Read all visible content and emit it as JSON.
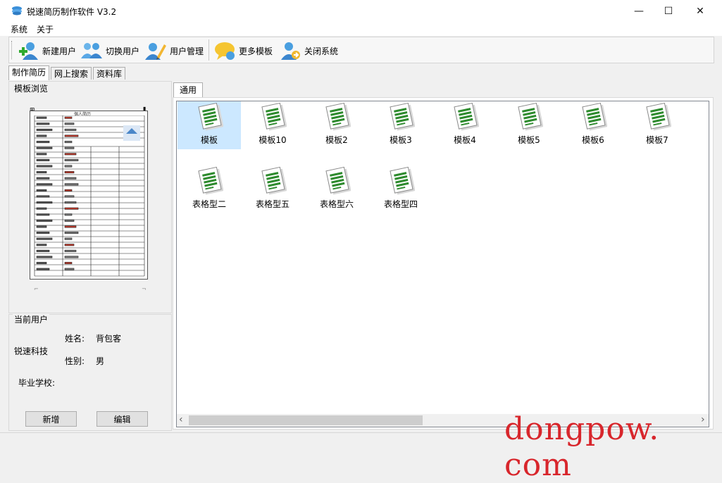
{
  "window": {
    "title": "锐速简历制作软件  V3.2",
    "minimize": "—",
    "maximize": "☐",
    "close": "✕"
  },
  "menu": [
    "系统",
    "关于"
  ],
  "toolbar": [
    {
      "label": "新建用户",
      "icon": "user-add-icon"
    },
    {
      "label": "切换用户",
      "icon": "users-switch-icon"
    },
    {
      "label": "用户管理",
      "icon": "user-edit-icon"
    },
    {
      "label": "更多模板",
      "icon": "chat-bubble-icon"
    },
    {
      "label": "关闭系统",
      "icon": "user-exit-icon"
    }
  ],
  "main_tabs": [
    "制作简历",
    "网上搜索",
    "资料库"
  ],
  "preview": {
    "caption": "模板浏览",
    "paper_title": "個人简历"
  },
  "current_user": {
    "caption": "当前用户",
    "company": "锐速科技",
    "name_label": "姓名:",
    "name_value": "背包客",
    "gender_label": "性别:",
    "gender_value": "男",
    "school_label": "毕业学校:",
    "add_button": "新增",
    "edit_button": "编辑"
  },
  "templates_tab": "通用",
  "templates": [
    {
      "label": "模板",
      "selected": true
    },
    {
      "label": "模板10"
    },
    {
      "label": "模板2"
    },
    {
      "label": "模板3"
    },
    {
      "label": "模板4"
    },
    {
      "label": "模板5"
    },
    {
      "label": "模板6"
    },
    {
      "label": "模板7"
    },
    {
      "label": "表格型二"
    },
    {
      "label": "表格型五"
    },
    {
      "label": "表格型六"
    },
    {
      "label": "表格型四"
    }
  ],
  "scroll": {
    "left_arrow": "‹",
    "right_arrow": "›",
    "horizontal_thumb_fraction": 0.45
  },
  "watermark": "dongpow. com",
  "colors": {
    "selection": "#cce8ff",
    "icon_green": "#2e8b2e",
    "watermark": "#d8262c"
  }
}
